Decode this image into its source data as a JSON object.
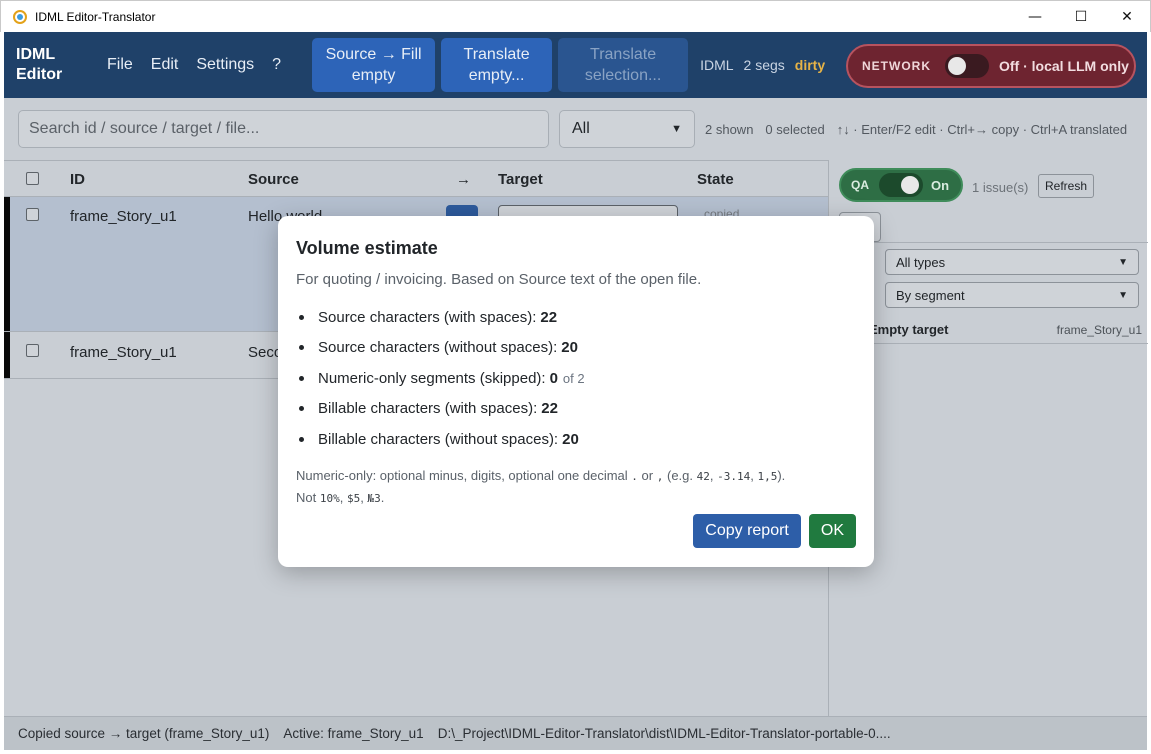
{
  "window": {
    "title": "IDML Editor-Translator",
    "minimize": "—",
    "maximize": "☐",
    "close": "✕"
  },
  "navbar": {
    "brand_line1": "IDML",
    "brand_line2": "Editor",
    "menu": [
      "File",
      "Edit",
      "Settings",
      "?"
    ],
    "btn_fill_line1": "Source → Fill",
    "btn_fill_line2": "empty",
    "btn_translate_empty_line1": "Translate",
    "btn_translate_empty_line2": "empty...",
    "btn_translate_sel_line1": "Translate",
    "btn_translate_sel_line2": "selection...",
    "doc_type": "IDML",
    "segs": "2 segs",
    "dirty": "dirty",
    "network_label": "NETWORK",
    "network_status": "Off · local LLM only"
  },
  "toolbar": {
    "search_placeholder": "Search id / source / target / file...",
    "filter_value": "All",
    "shown": "2 shown",
    "selected": "0 selected",
    "hint": "↑↓ · Enter/F2 edit · Ctrl+→ copy · Ctrl+A translated"
  },
  "table": {
    "headers": {
      "id": "ID",
      "source": "Source",
      "arrow": "→",
      "target": "Target",
      "state": "State"
    },
    "rows": [
      {
        "id": "frame_Story_u1",
        "source": "Hello world",
        "state": "copied"
      },
      {
        "id": "frame_Story_u1",
        "source": "Seco"
      }
    ]
  },
  "qa": {
    "label": "QA",
    "state": "On",
    "issues": "1 issue(s)",
    "refresh": "Refresh",
    "type_filter": "All types",
    "group_filter": "By segment",
    "issue_type": "Empty target",
    "issue_id": "frame_Story_u1"
  },
  "statusbar": {
    "message": "Copied source → target (frame_Story_u1)",
    "active": "Active: frame_Story_u1",
    "path": "D:\\_Project\\IDML-Editor-Translator\\dist\\IDML-Editor-Translator-portable-0...."
  },
  "modal": {
    "title": "Volume estimate",
    "subtitle": "For quoting / invoicing. Based on Source text of the open file.",
    "stats": [
      {
        "label": "Source characters (with spaces):",
        "value": "22"
      },
      {
        "label": "Source characters (without spaces):",
        "value": "20"
      },
      {
        "label": "Numeric-only segments (skipped):",
        "value": "0",
        "of": "of 2"
      },
      {
        "label": "Billable characters (with spaces):",
        "value": "22"
      },
      {
        "label": "Billable characters (without spaces):",
        "value": "20"
      }
    ],
    "note_prefix": "Numeric-only: optional minus, digits, optional one decimal",
    "note_dot": ".",
    "note_or": "or",
    "note_comma": ",",
    "note_eg": "(e.g.",
    "note_ex1": "42",
    "note_ex2": "-3.14",
    "note_ex3": "1,5",
    "note_eg_end": ").",
    "note_not": "Not",
    "note_nex1": "10%",
    "note_nex2": "$5",
    "note_nex3": "№3",
    "copy_report": "Copy report",
    "ok": "OK"
  },
  "colors": {
    "navbar": "#1f4169",
    "primary": "#2d5ea8",
    "success": "#207a3f",
    "network_off": "#6e2430",
    "dirty": "#e6b347"
  }
}
